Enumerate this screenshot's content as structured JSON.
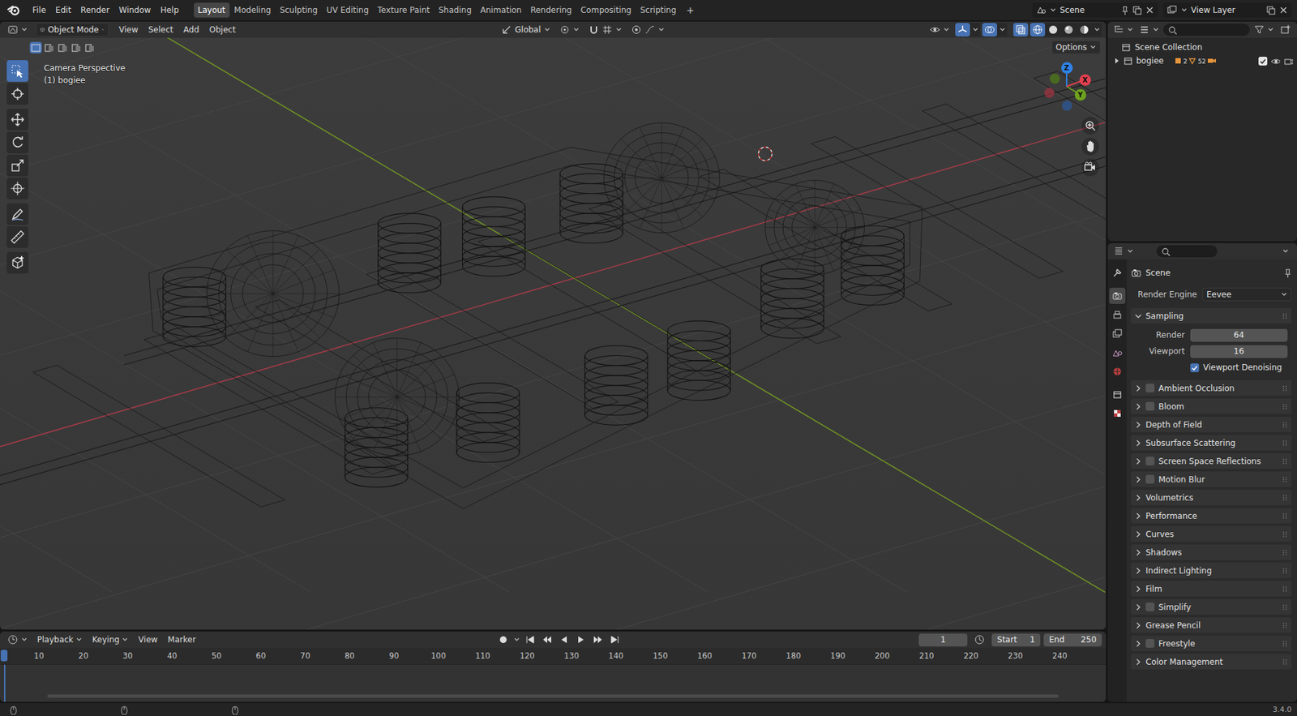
{
  "topbar": {
    "menus": [
      "File",
      "Edit",
      "Render",
      "Window",
      "Help"
    ],
    "workspaces": [
      {
        "label": "Layout",
        "selected": true
      },
      {
        "label": "Modeling",
        "selected": false
      },
      {
        "label": "Sculpting",
        "selected": false
      },
      {
        "label": "UV Editing",
        "selected": false
      },
      {
        "label": "Texture Paint",
        "selected": false
      },
      {
        "label": "Shading",
        "selected": false
      },
      {
        "label": "Animation",
        "selected": false
      },
      {
        "label": "Rendering",
        "selected": false
      },
      {
        "label": "Compositing",
        "selected": false
      },
      {
        "label": "Scripting",
        "selected": false
      }
    ],
    "add_workspace": "+",
    "scene": "Scene",
    "view_layer": "View Layer"
  },
  "viewport": {
    "mode": "Object Mode",
    "menus": [
      "View",
      "Select",
      "Add",
      "Object"
    ],
    "orientation": "Global",
    "options": "Options",
    "select_modes": [
      {
        "selected": true
      },
      {
        "selected": false
      },
      {
        "selected": false
      },
      {
        "selected": false
      },
      {
        "selected": false
      }
    ],
    "gizmos": {
      "on": true
    },
    "overlays": {
      "on": true
    },
    "xray": {
      "on": true
    },
    "shading": [
      {
        "kind": "wireframe",
        "selected": true
      },
      {
        "kind": "solid",
        "selected": false
      },
      {
        "kind": "material",
        "selected": false
      },
      {
        "kind": "rendered",
        "selected": false
      }
    ],
    "info": [
      "Camera Perspective",
      "(1) bogiee"
    ],
    "tools": [
      {
        "kind": "select",
        "selected": true
      },
      {
        "kind": "cursor",
        "selected": false
      },
      {
        "kind": "move",
        "selected": false
      },
      {
        "kind": "rotate",
        "selected": false
      },
      {
        "kind": "scale",
        "selected": false
      },
      {
        "kind": "transform",
        "selected": false
      },
      {
        "kind": "annotate",
        "selected": false
      },
      {
        "kind": "measure",
        "selected": false
      },
      {
        "kind": "add-cube",
        "selected": false
      }
    ],
    "axes": [
      {
        "label": "Z",
        "color": "#2f83e8"
      },
      {
        "label": "Y",
        "color": "#6ea21e"
      },
      {
        "label": "X",
        "color": "#e2404f"
      }
    ],
    "axes_negative": [
      {
        "color": "#2c5a9a"
      },
      {
        "color": "#4f7a18"
      },
      {
        "color": "#9c3440"
      }
    ]
  },
  "outliner": {
    "root": "Scene Collection",
    "items": [
      {
        "name": "bogiee",
        "expanded": false,
        "counts": [
          "2",
          "52"
        ],
        "checked": true,
        "visible": true,
        "renderable": true
      }
    ]
  },
  "properties": {
    "tabs": [
      {
        "kind": "tool",
        "selected": false
      },
      {
        "kind": "render",
        "selected": true
      },
      {
        "kind": "output",
        "selected": false
      },
      {
        "kind": "view-layer",
        "selected": false
      },
      {
        "kind": "scene",
        "selected": false
      },
      {
        "kind": "world",
        "selected": false
      },
      {
        "kind": "collection",
        "selected": false
      },
      {
        "kind": "texture",
        "selected": false
      }
    ],
    "context": "Scene",
    "render_engine": {
      "label": "Render Engine",
      "value": "Eevee"
    },
    "panels": [
      {
        "label": "Sampling",
        "kind": "plain",
        "expanded": true
      },
      {
        "label": "Ambient Occlusion",
        "kind": "checkbox",
        "checked": false,
        "expanded": false
      },
      {
        "label": "Bloom",
        "kind": "checkbox",
        "checked": false,
        "expanded": false
      },
      {
        "label": "Depth of Field",
        "kind": "plain",
        "expanded": false
      },
      {
        "label": "Subsurface Scattering",
        "kind": "plain",
        "expanded": false
      },
      {
        "label": "Screen Space Reflections",
        "kind": "checkbox",
        "checked": false,
        "expanded": false
      },
      {
        "label": "Motion Blur",
        "kind": "checkbox",
        "checked": false,
        "expanded": false
      },
      {
        "label": "Volumetrics",
        "kind": "plain",
        "expanded": false
      },
      {
        "label": "Performance",
        "kind": "plain",
        "expanded": false
      },
      {
        "label": "Curves",
        "kind": "plain",
        "expanded": false
      },
      {
        "label": "Shadows",
        "kind": "plain",
        "expanded": false
      },
      {
        "label": "Indirect Lighting",
        "kind": "plain",
        "expanded": false
      },
      {
        "label": "Film",
        "kind": "plain",
        "expanded": false
      },
      {
        "label": "Simplify",
        "kind": "checkbox",
        "checked": false,
        "expanded": false
      },
      {
        "label": "Grease Pencil",
        "kind": "plain",
        "expanded": false
      },
      {
        "label": "Freestyle",
        "kind": "checkbox",
        "checked": false,
        "expanded": false
      },
      {
        "label": "Color Management",
        "kind": "plain",
        "expanded": false
      }
    ],
    "sampling": {
      "fields": [
        {
          "label": "Render",
          "value": "64"
        },
        {
          "label": "Viewport",
          "value": "16"
        }
      ],
      "denoising": {
        "label": "Viewport Denoising",
        "checked": true
      }
    }
  },
  "timeline": {
    "menus": [
      "Playback",
      "Keying",
      "View",
      "Marker"
    ],
    "auto_key": {
      "on": false
    },
    "current_frame": "1",
    "start": {
      "label": "Start",
      "value": "1"
    },
    "end": {
      "label": "End",
      "value": "250"
    },
    "ticks": [
      "10",
      "20",
      "30",
      "40",
      "50",
      "60",
      "70",
      "80",
      "90",
      "100",
      "110",
      "120",
      "130",
      "140",
      "150",
      "160",
      "170",
      "180",
      "190",
      "200",
      "210",
      "220",
      "230",
      "240"
    ]
  },
  "status_bar": {
    "version": "3.4.0"
  }
}
